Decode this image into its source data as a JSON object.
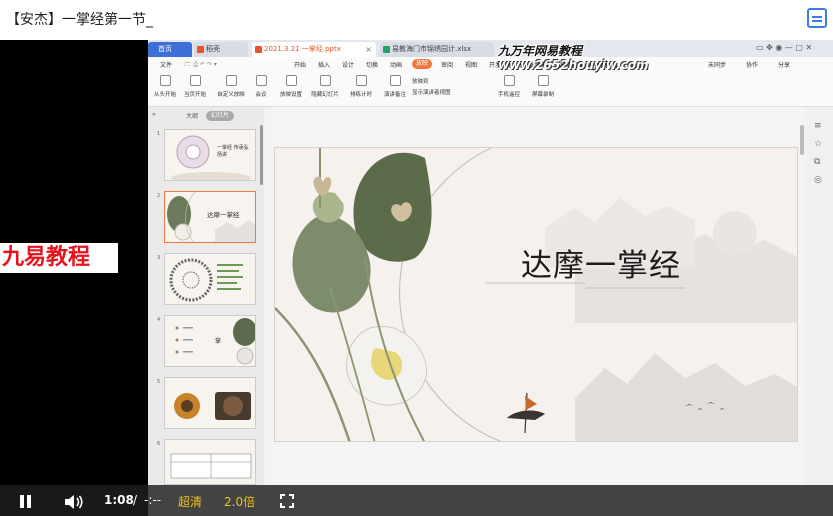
{
  "window": {
    "title": "【安杰】一掌经第一节_"
  },
  "watermarks": {
    "left_brand": "九易教程",
    "corner_line1": "九万年网易教程",
    "corner_line2": "www.2652houyiw.com"
  },
  "wps": {
    "tabs": [
      {
        "label": "首页",
        "color": "#3d6fd8"
      },
      {
        "label": "稻壳",
        "color": "#e8552d"
      },
      {
        "label": "2021.3.21 一掌经.pptx",
        "color": "#e8552d"
      },
      {
        "label": "易教海门市锦绣园计.xlsx",
        "color": "#21a366"
      }
    ],
    "menu": [
      "文件",
      "开始",
      "插入",
      "设计",
      "切换",
      "动画",
      "放映",
      "审阅",
      "视图",
      "开发工具",
      "会员专享",
      "稻壳资源"
    ],
    "menu_active": "放映",
    "menu_right": [
      "未同步",
      "协作",
      "分享"
    ],
    "ribbon": [
      "从头开始",
      "当页开始",
      "自定义放映",
      "会议",
      "放映设置",
      "隐藏幻灯片",
      "排练计时",
      "演讲备注",
      "屏幕录制",
      "手机遥控",
      "屏幕录制"
    ],
    "ribbon_checks": [
      "放映到",
      "显示演讲者视图"
    ],
    "pane_tabs": [
      "大纲",
      "幻灯片"
    ],
    "pane_active": "幻灯片",
    "thumbnails": [
      {
        "num": "1",
        "text": "一掌经 传承弘扬讲"
      },
      {
        "num": "2",
        "text": "达摩一掌经"
      },
      {
        "num": "3",
        "text": ""
      },
      {
        "num": "4",
        "text": "掌"
      },
      {
        "num": "5",
        "text": ""
      },
      {
        "num": "6",
        "text": ""
      }
    ],
    "slide_title": "达摩一掌经"
  },
  "player": {
    "time_current": "1:08",
    "time_separator": "/",
    "time_total": "-:--",
    "quality": "超清",
    "speed": "2.0倍",
    "accent": "#f0c020"
  }
}
